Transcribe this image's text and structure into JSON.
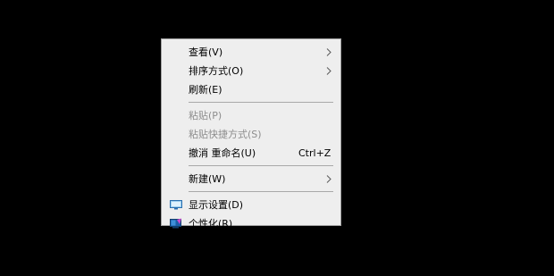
{
  "context_menu": {
    "items": [
      {
        "label": "查看(V)",
        "has_submenu": true,
        "enabled": true
      },
      {
        "label": "排序方式(O)",
        "has_submenu": true,
        "enabled": true
      },
      {
        "label": "刷新(E)",
        "has_submenu": false,
        "enabled": true
      },
      {
        "label": "粘贴(P)",
        "has_submenu": false,
        "enabled": false
      },
      {
        "label": "粘贴快捷方式(S)",
        "has_submenu": false,
        "enabled": false
      },
      {
        "label": "撤消 重命名(U)",
        "shortcut": "Ctrl+Z",
        "has_submenu": false,
        "enabled": true
      },
      {
        "label": "新建(W)",
        "has_submenu": true,
        "enabled": true
      },
      {
        "label": "显示设置(D)",
        "icon": "display-settings-icon",
        "has_submenu": false,
        "enabled": true
      },
      {
        "label": "个性化(R)",
        "icon": "personalize-icon",
        "has_submenu": false,
        "enabled": true
      }
    ]
  },
  "colors": {
    "desktop_background": "#000000",
    "menu_background": "#eeeeee",
    "menu_border": "#a0a0a0",
    "disabled_text": "#8d8d8d"
  }
}
